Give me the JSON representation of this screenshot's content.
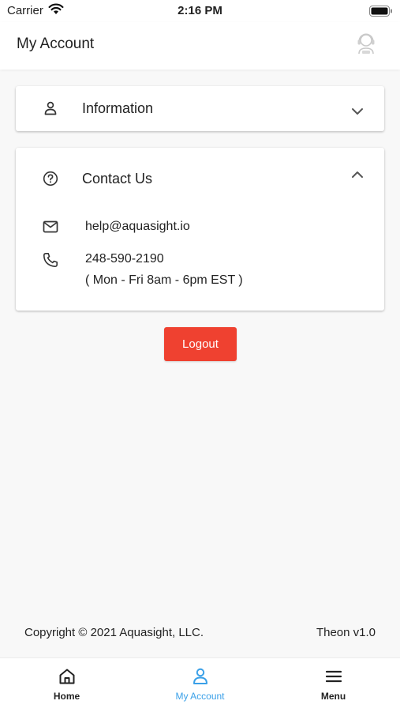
{
  "status_bar": {
    "carrier": "Carrier",
    "time": "2:16 PM"
  },
  "header": {
    "title": "My Account",
    "avatar_icon": "support-agent-icon"
  },
  "sections": {
    "information": {
      "label": "Information",
      "icon": "person-icon",
      "expanded": false
    },
    "contact": {
      "label": "Contact Us",
      "icon": "help-circle-icon",
      "expanded": true,
      "email": "help@aquasight.io",
      "phone": "248-590-2190",
      "hours": "( Mon - Fri 8am - 6pm EST )"
    }
  },
  "actions": {
    "logout_label": "Logout",
    "logout_color": "#ef4130"
  },
  "footer": {
    "copyright": "Copyright © 2021 Aquasight, LLC.",
    "version": "Theon v1.0"
  },
  "tabs": [
    {
      "label": "Home",
      "icon": "home-icon",
      "active": false
    },
    {
      "label": "My Account",
      "icon": "person-icon",
      "active": true
    },
    {
      "label": "Menu",
      "icon": "menu-icon",
      "active": false
    }
  ],
  "colors": {
    "active_tab": "#3aa0e8",
    "inactive_tab": "#222222"
  }
}
